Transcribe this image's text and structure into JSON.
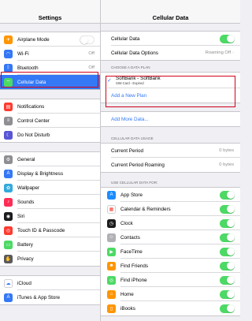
{
  "status_bar": {
    "device": "iPad",
    "time": ""
  },
  "sidebar": {
    "title": "Settings",
    "group1": [
      {
        "label": "Airplane Mode",
        "icon": "airplane-icon",
        "color": "#ff9500",
        "glyph": "✈",
        "toggle": "off"
      },
      {
        "label": "Wi-Fi",
        "value": "Off",
        "icon": "wifi-icon",
        "color": "#3478f6",
        "glyph": "◠"
      },
      {
        "label": "Bluetooth",
        "value": "Off",
        "icon": "bluetooth-icon",
        "color": "#3478f6",
        "glyph": "ᛒ"
      },
      {
        "label": "Cellular Data",
        "icon": "cellular-icon",
        "color": "#4cd964",
        "glyph": "⌔",
        "selected": true
      }
    ],
    "group2": [
      {
        "label": "Notifications",
        "icon": "notifications-icon",
        "color": "#ff3b30",
        "glyph": "▤"
      },
      {
        "label": "Control Center",
        "icon": "control-center-icon",
        "color": "#8e8e93",
        "glyph": "≡"
      },
      {
        "label": "Do Not Disturb",
        "icon": "moon-icon",
        "color": "#5856d6",
        "glyph": "☾"
      }
    ],
    "group3": [
      {
        "label": "General",
        "icon": "gear-icon",
        "color": "#8e8e93",
        "glyph": "⚙"
      },
      {
        "label": "Display & Brightness",
        "icon": "display-icon",
        "color": "#3478f6",
        "glyph": "A"
      },
      {
        "label": "Wallpaper",
        "icon": "wallpaper-icon",
        "color": "#34aadc",
        "glyph": "✿"
      },
      {
        "label": "Sounds",
        "icon": "sounds-icon",
        "color": "#ff2d55",
        "glyph": "♪"
      },
      {
        "label": "Siri",
        "icon": "siri-icon",
        "color": "#1c1c1e",
        "glyph": "◉"
      },
      {
        "label": "Touch ID & Passcode",
        "icon": "fingerprint-icon",
        "color": "#ff3b30",
        "glyph": "◎"
      },
      {
        "label": "Battery",
        "icon": "battery-icon",
        "color": "#4cd964",
        "glyph": "▭"
      },
      {
        "label": "Privacy",
        "icon": "privacy-icon",
        "color": "#5a5a5e",
        "glyph": "✋"
      }
    ],
    "group4": [
      {
        "label": "iCloud",
        "icon": "icloud-icon",
        "color": "#ffffff",
        "glyph": "☁",
        "glyph_color": "#3478f6"
      },
      {
        "label": "iTunes & App Store",
        "icon": "app-store-icon",
        "color": "#3478f6",
        "glyph": "A"
      }
    ]
  },
  "main": {
    "title": "Cellular Data",
    "top_rows": [
      {
        "label": "Cellular Data",
        "toggle": "on"
      },
      {
        "label": "Cellular Data Options",
        "value": "Roaming Off",
        "chevron": "›"
      }
    ],
    "plan_section_label": "CHOOSE A DATA PLAN",
    "plan": {
      "name": "SoftBank - SoftBank",
      "sub": "SIM Card - Expired",
      "check": "✓"
    },
    "add_new_plan": "Add a New Plan",
    "add_more_data": "Add More Data...",
    "usage_section_label": "CELLULAR DATA USAGE",
    "usage_rows": [
      {
        "label": "Current Period",
        "value": "0 bytes"
      },
      {
        "label": "Current Period Roaming",
        "value": "0 bytes"
      }
    ],
    "apps_section_label": "USE CELLULAR DATA FOR:",
    "apps": [
      {
        "label": "App Store",
        "icon": "app-store-icon",
        "color": "#1a8cff",
        "glyph": "A"
      },
      {
        "label": "Calendar & Reminders",
        "icon": "calendar-icon",
        "color": "#ffffff",
        "glyph": "▦",
        "glyph_color": "#ff3b30"
      },
      {
        "label": "Clock",
        "icon": "clock-icon",
        "color": "#1c1c1e",
        "glyph": "◷"
      },
      {
        "label": "Contacts",
        "icon": "contacts-icon",
        "color": "#b0b0b5",
        "glyph": "☺"
      },
      {
        "label": "FaceTime",
        "icon": "facetime-icon",
        "color": "#4cd964",
        "glyph": "▶"
      },
      {
        "label": "Find Friends",
        "icon": "find-friends-icon",
        "color": "#ff9500",
        "glyph": "☻"
      },
      {
        "label": "Find iPhone",
        "icon": "find-iphone-icon",
        "color": "#4cd964",
        "glyph": "◎"
      },
      {
        "label": "Home",
        "icon": "home-icon",
        "color": "#ff9500",
        "glyph": "⌂"
      },
      {
        "label": "iBooks",
        "icon": "ibooks-icon",
        "color": "#ff9500",
        "glyph": "▯"
      }
    ]
  },
  "colors": {
    "accent": "#3478f6",
    "highlight": "#d0021b",
    "toggle_on": "#4cd964"
  }
}
